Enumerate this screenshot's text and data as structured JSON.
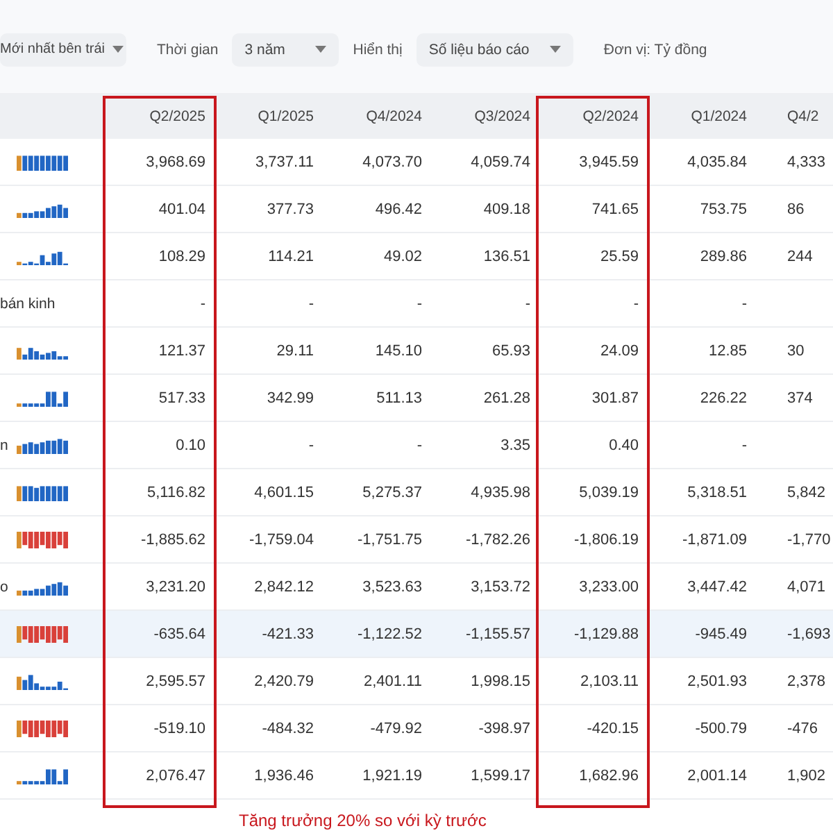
{
  "toolbar": {
    "order_dropdown": {
      "value": "Mới nhất bên trái"
    },
    "period": {
      "label": "Thời gian",
      "value": "3 năm"
    },
    "display": {
      "label": "Hiển thị",
      "value": "Số liệu báo cáo"
    },
    "unit": "Đơn vị: Tỷ đồng"
  },
  "table": {
    "columns": [
      {
        "label": "Q2/2025",
        "highlighted": true
      },
      {
        "label": "Q1/2025",
        "highlighted": false
      },
      {
        "label": "Q4/2024",
        "highlighted": false
      },
      {
        "label": "Q3/2024",
        "highlighted": false
      },
      {
        "label": "Q2/2024",
        "highlighted": true
      },
      {
        "label": "Q1/2024",
        "highlighted": false
      },
      {
        "label": "Q4/2",
        "highlighted": false
      }
    ],
    "rows": [
      {
        "kind": "positive",
        "selected": false,
        "values": [
          "3,968.69",
          "3,737.11",
          "4,073.70",
          "4,059.74",
          "3,945.59",
          "4,035.84",
          "4,333"
        ]
      },
      {
        "kind": "positive",
        "selected": false,
        "values": [
          "401.04",
          "377.73",
          "496.42",
          "409.18",
          "741.65",
          "753.75",
          "86"
        ]
      },
      {
        "kind": "positive",
        "selected": false,
        "values": [
          "108.29",
          "114.21",
          "49.02",
          "136.51",
          "25.59",
          "289.86",
          "244"
        ]
      },
      {
        "label": "bán kinh",
        "selected": false,
        "values": [
          "-",
          "-",
          "-",
          "-",
          "-",
          "-"
        ]
      },
      {
        "kind": "positive",
        "selected": false,
        "values": [
          "121.37",
          "29.11",
          "145.10",
          "65.93",
          "24.09",
          "12.85",
          "30"
        ]
      },
      {
        "kind": "positive",
        "selected": false,
        "values": [
          "517.33",
          "342.99",
          "511.13",
          "261.28",
          "301.87",
          "226.22",
          "374"
        ]
      },
      {
        "label": "n",
        "kind": "positive",
        "selected": false,
        "values": [
          "0.10",
          "-",
          "-",
          "3.35",
          "0.40",
          "-"
        ]
      },
      {
        "kind": "positive",
        "selected": false,
        "values": [
          "5,116.82",
          "4,601.15",
          "5,275.37",
          "4,935.98",
          "5,039.19",
          "5,318.51",
          "5,842"
        ]
      },
      {
        "kind": "negative",
        "selected": false,
        "values": [
          "-1,885.62",
          "-1,759.04",
          "-1,751.75",
          "-1,782.26",
          "-1,806.19",
          "-1,871.09",
          "-1,770"
        ]
      },
      {
        "label": "o",
        "kind": "positive",
        "selected": false,
        "values": [
          "3,231.20",
          "2,842.12",
          "3,523.63",
          "3,153.72",
          "3,233.00",
          "3,447.42",
          "4,071"
        ]
      },
      {
        "kind": "negative",
        "selected": true,
        "values": [
          "-635.64",
          "-421.33",
          "-1,122.52",
          "-1,155.57",
          "-1,129.88",
          "-945.49",
          "-1,693"
        ]
      },
      {
        "kind": "positive",
        "selected": false,
        "values": [
          "2,595.57",
          "2,420.79",
          "2,401.11",
          "1,998.15",
          "2,103.11",
          "2,501.93",
          "2,378"
        ]
      },
      {
        "kind": "negative",
        "selected": false,
        "values": [
          "-519.10",
          "-484.32",
          "-479.92",
          "-398.97",
          "-420.15",
          "-500.79",
          "-476"
        ]
      },
      {
        "kind": "positive",
        "selected": false,
        "values": [
          "2,076.47",
          "1,936.46",
          "1,921.19",
          "1,599.17",
          "1,682.96",
          "2,001.14",
          "1,902"
        ]
      }
    ]
  },
  "annotation": "Tăng trưởng 20% so với kỳ trước"
}
